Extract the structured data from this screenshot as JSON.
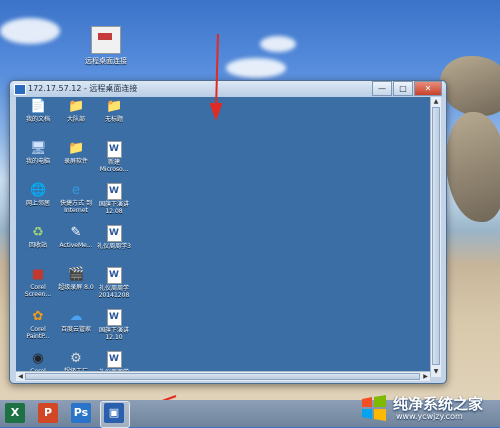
{
  "desktop": {
    "shortcut_label": "远程桌面连接"
  },
  "rdp_window": {
    "title": "172.17.57.12 - 远程桌面连接",
    "minimize": "—",
    "maximize": "□",
    "close": "✕"
  },
  "remote_icons": [
    {
      "label": "我的文档",
      "icon": "my-documents-icon",
      "glyph": "📄",
      "color": "#f2d36b"
    },
    {
      "label": "大队部",
      "icon": "folder-icon",
      "glyph": "📁",
      "color": "#f4cf5a"
    },
    {
      "label": "无标题",
      "icon": "folder-icon",
      "glyph": "📁",
      "color": "#f4cf5a"
    },
    {
      "label": "我的电脑",
      "icon": "my-computer-icon",
      "glyph": "🖥",
      "color": "#cde3ff"
    },
    {
      "label": "录屏软件",
      "icon": "folder-icon",
      "glyph": "📁",
      "color": "#f4cf5a"
    },
    {
      "label": "新建 Microso...",
      "icon": "word-document-icon",
      "glyph": "W",
      "color": "#2b579a"
    },
    {
      "label": "网上邻居",
      "icon": "network-icon",
      "glyph": "🌐",
      "color": "#7ed1ff"
    },
    {
      "label": "快捷方式 到 Internet",
      "icon": "internet-explorer-icon",
      "glyph": "e",
      "color": "#2f9be3"
    },
    {
      "label": "国旗下演讲 12.08",
      "icon": "word-document-icon",
      "glyph": "W",
      "color": "#2b579a"
    },
    {
      "label": "回收站",
      "icon": "recycle-bin-icon",
      "glyph": "♻",
      "color": "#9ed27a"
    },
    {
      "label": "ActiveMe...",
      "icon": "activeme-icon",
      "glyph": "✎",
      "color": "#ffffff"
    },
    {
      "label": "礼仪周周学3",
      "icon": "word-document-icon",
      "glyph": "W",
      "color": "#2b579a"
    },
    {
      "label": "Corel Screen...",
      "icon": "corel-screen-icon",
      "glyph": "■",
      "color": "#c0392b"
    },
    {
      "label": "超级录屏 8.0",
      "icon": "screen-recorder-icon",
      "glyph": "🎬",
      "color": "#ffffff"
    },
    {
      "label": "礼仪周周学 20141208",
      "icon": "word-document-icon",
      "glyph": "W",
      "color": "#2b579a"
    },
    {
      "label": "Corel PaintP...",
      "icon": "corel-paint-icon",
      "glyph": "✿",
      "color": "#f39c12"
    },
    {
      "label": "百度云管家",
      "icon": "baidu-cloud-icon",
      "glyph": "☁",
      "color": "#4aa3f0"
    },
    {
      "label": "国旗下演讲 12.10",
      "icon": "word-document-icon",
      "glyph": "W",
      "color": "#2b579a"
    },
    {
      "label": "Corel",
      "icon": "corel-icon",
      "glyph": "◉",
      "color": "#222222"
    },
    {
      "label": "超级工厂",
      "icon": "format-factory-icon",
      "glyph": "⚙",
      "color": "#dddddd"
    },
    {
      "label": "礼仪周周学",
      "icon": "word-document-icon",
      "glyph": "W",
      "color": "#2b579a"
    }
  ],
  "taskbar": {
    "apps": [
      {
        "name": "excel",
        "glyph": "X",
        "color": "#1e7145"
      },
      {
        "name": "powerpoint",
        "glyph": "P",
        "color": "#d24726"
      },
      {
        "name": "photoshop",
        "glyph": "Ps",
        "color": "#2a74c9"
      },
      {
        "name": "remote-desktop",
        "glyph": "▣",
        "color": "#2a5fae"
      }
    ]
  },
  "watermark": {
    "text": "纯净系统之家",
    "url": "www.ycwjzy.com"
  }
}
